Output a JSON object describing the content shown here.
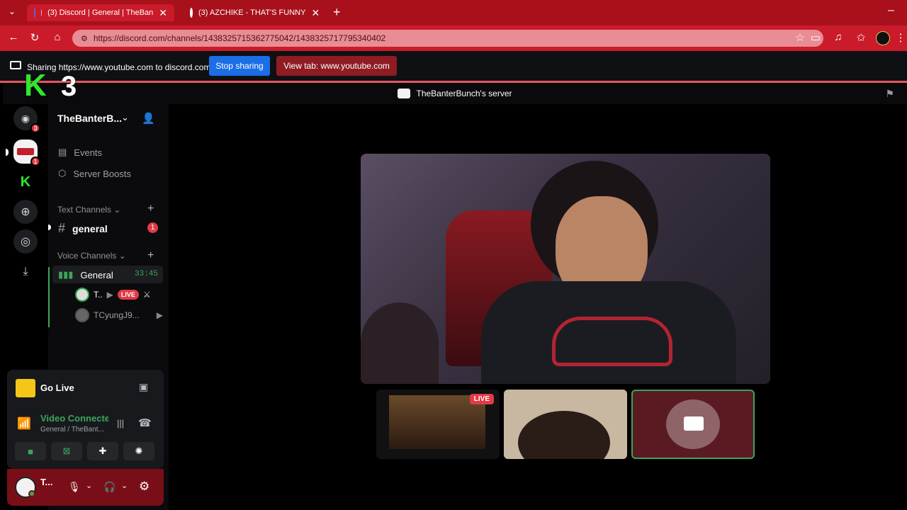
{
  "browser": {
    "tabs": [
      {
        "label": "(3) Discord | General | TheBan",
        "active": true
      },
      {
        "label": "(3) AZCHIKE - THAT'S FUNNY",
        "active": false
      }
    ],
    "url": "https://discord.com/channels/1438325715362775042/1438325717795340402"
  },
  "sharing": {
    "message": "Sharing https://www.youtube.com to discord.com",
    "stop_label": "Stop sharing",
    "view_label": "View tab: www.youtube.com"
  },
  "overlay_logo": {
    "letter": "K",
    "number": "3"
  },
  "discord": {
    "window_title": "TheBanterBunch's server",
    "dm_badge": "3",
    "server_badge": "1",
    "server_name": "TheBanterB...",
    "nav_items": [
      {
        "label": "Events",
        "icon": "calendar-icon"
      },
      {
        "label": "Server Boosts",
        "icon": "boost-icon"
      }
    ],
    "text_category": "Text Channels",
    "text_channel": {
      "name": "general",
      "badge": "1"
    },
    "voice_category": "Voice Channels",
    "voice_channel": {
      "name": "General",
      "timer": "33:45"
    },
    "voice_users": [
      {
        "name": "T..",
        "live": "LIVE"
      },
      {
        "name": "TCyungJ9..."
      }
    ],
    "go_live_label": "Go Live",
    "connection": {
      "status": "Video Connecte",
      "location": "General / TheBant..."
    },
    "user": {
      "name": "T..."
    },
    "thumbnails": [
      {
        "live": "LIVE"
      }
    ]
  },
  "colors": {
    "tab_strip": "#a8101c",
    "nav_bar": "#c91b2a",
    "accent_green": "#3ba55c",
    "live_red": "#e23b45",
    "stop_blue": "#1b6ee6"
  }
}
